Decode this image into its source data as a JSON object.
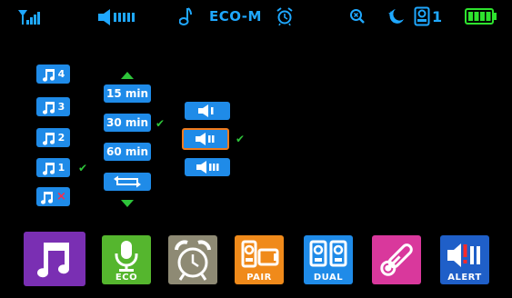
{
  "status_bar": {
    "mode_label": "ECO-M",
    "camera_count": "1"
  },
  "music_tracks": [
    {
      "number": "4",
      "selected": false
    },
    {
      "number": "3",
      "selected": false
    },
    {
      "number": "2",
      "selected": false
    },
    {
      "number": "1",
      "selected": true
    }
  ],
  "music_off": {
    "mark": "×"
  },
  "timers": {
    "options": [
      "15 min",
      "30 min",
      "60 min"
    ],
    "selected": "30 min"
  },
  "volume_levels": {
    "count": 3,
    "selected_index": 1
  },
  "bottom_menu": [
    {
      "id": "music",
      "label": "",
      "color": "#7a2fb3"
    },
    {
      "id": "eco",
      "label": "ECO",
      "color": "#55b62e"
    },
    {
      "id": "alarm",
      "label": "",
      "color": "#8e8a74"
    },
    {
      "id": "pair",
      "label": "PAIR",
      "color": "#f08a1a"
    },
    {
      "id": "dual",
      "label": "DUAL",
      "color": "#1f8be8"
    },
    {
      "id": "temperature",
      "label": "",
      "color": "#d9389c"
    },
    {
      "id": "alert",
      "label": "ALERT",
      "color": "#1f5fc8"
    }
  ],
  "colors": {
    "accent_blue": "#1fa8ff",
    "chip_blue": "#1f8be8",
    "check_green": "#2ec43a",
    "selection_orange": "#f07b1e",
    "battery_green": "#2ee32e"
  }
}
